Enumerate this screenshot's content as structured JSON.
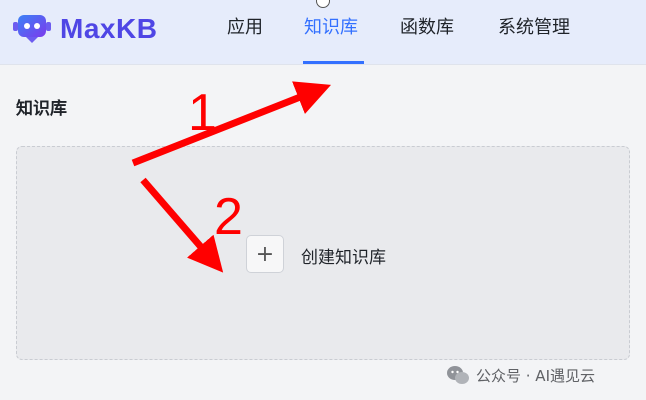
{
  "brand": {
    "name": "MaxKB"
  },
  "nav": {
    "items": [
      {
        "label": "应用",
        "active": false
      },
      {
        "label": "知识库",
        "active": true
      },
      {
        "label": "函数库",
        "active": false
      },
      {
        "label": "系统管理",
        "active": false
      }
    ]
  },
  "page": {
    "title": "知识库"
  },
  "create_card": {
    "plus": "+",
    "label": "创建知识库"
  },
  "annotations": {
    "step1": "1",
    "step2": "2",
    "arrow_color": "#ff0000"
  },
  "watermark": {
    "text": "公众号 · AI遇见云",
    "icon": "wechat-icon"
  },
  "colors": {
    "accent": "#3370ff",
    "brand": "#4f46e5",
    "header_bg": "#e6ecfb"
  }
}
